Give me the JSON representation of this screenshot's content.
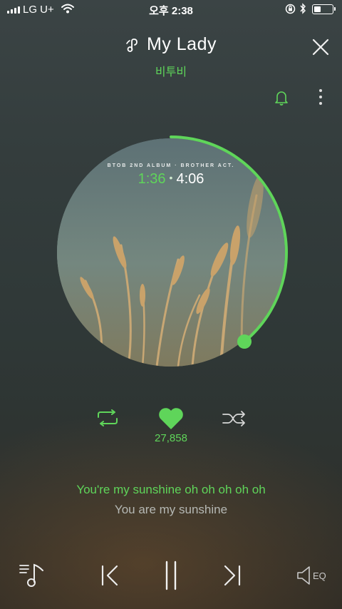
{
  "status_bar": {
    "carrier": "LG U+",
    "time": "오후 2:38",
    "icons": [
      "signal-icon",
      "wifi-icon",
      "rotation-lock-icon",
      "bluetooth-icon",
      "battery-icon"
    ]
  },
  "header": {
    "title": "My Lady",
    "artist": "비투비",
    "title_icon": "music-hand-icon",
    "close_icon": "close-icon",
    "alarm_icon": "bell-icon",
    "more_icon": "more-vertical-icon"
  },
  "player": {
    "album_caption": "BTOB 2ND ALBUM · BROTHER ACT.",
    "elapsed": "1:36",
    "separator": "•",
    "duration": "4:06",
    "progress": 0.39,
    "accent_color": "#5fd55a"
  },
  "actions": {
    "repeat_icon": "repeat-icon",
    "like_icon": "heart-icon",
    "like_count": "27,858",
    "shuffle_icon": "shuffle-icon"
  },
  "lyrics": {
    "current": "You're my sunshine oh oh oh oh oh",
    "next": "You are my sunshine"
  },
  "controls": {
    "playlist_icon": "playlist-icon",
    "prev_icon": "previous-icon",
    "pause_icon": "pause-icon",
    "next_icon": "next-icon",
    "eq_label": "EQ"
  }
}
